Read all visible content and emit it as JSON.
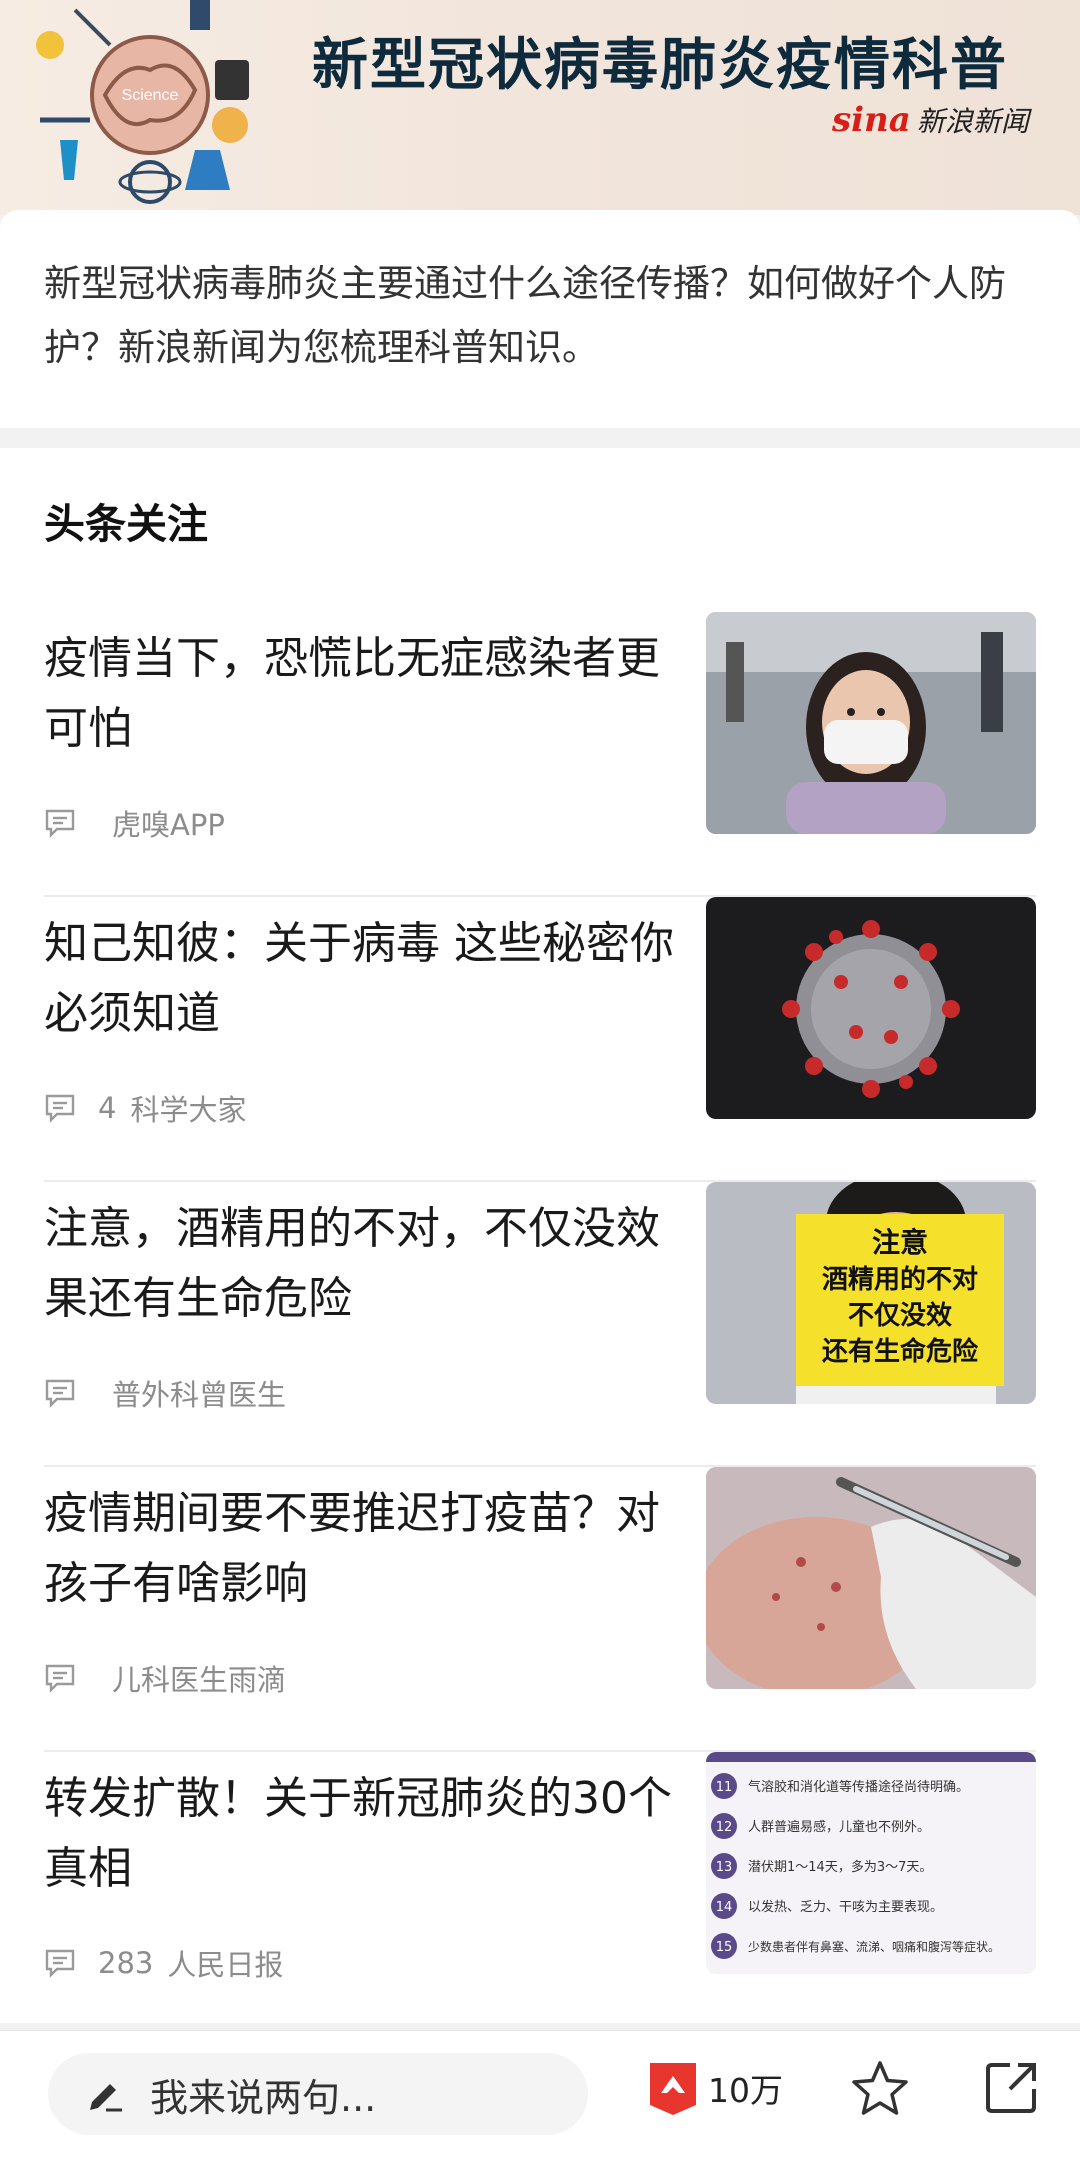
{
  "banner": {
    "title": "新型冠状病毒肺炎疫情科普",
    "illustration_label": "Science",
    "logo_mark": "sina",
    "logo_text": "新浪新闻"
  },
  "intro": {
    "text": "新型冠状病毒肺炎主要通过什么途径传播？如何做好个人防护？新浪新闻为您梳理科普知识。"
  },
  "section": {
    "title": "头条关注"
  },
  "articles": [
    {
      "title": "疫情当下，恐慌比无症感染者更可怕",
      "comment_count": "",
      "source": "虎嗅APP",
      "thumb": "girl-mask-photo"
    },
    {
      "title": "知己知彼：关于病毒 这些秘密你必须知道",
      "comment_count": "4",
      "source": "科学大家",
      "thumb": "virus-render"
    },
    {
      "title": "注意，酒精用的不对，不仅没效果还有生命危险",
      "comment_count": "",
      "source": "普外科曾医生",
      "thumb": "alcohol-warning",
      "thumb_text": [
        "注意",
        "酒精用的不对",
        "不仅没效",
        "还有生命危险"
      ]
    },
    {
      "title": "疫情期间要不要推迟打疫苗？对孩子有啥影响",
      "comment_count": "",
      "source": "儿科医生雨滴",
      "thumb": "vaccine-photo"
    },
    {
      "title": "转发扩散！关于新冠肺炎的30个真相",
      "comment_count": "283",
      "source": "人民日报",
      "thumb": "facts-list",
      "thumb_list": [
        {
          "n": "11",
          "text": "气溶胶和消化道等传播途径尚待明确。"
        },
        {
          "n": "12",
          "text": "人群普遍易感，儿童也不例外。"
        },
        {
          "n": "13",
          "text": "潜伏期1～14天，多为3～7天。"
        },
        {
          "n": "14",
          "text": "以发热、乏力、干咳为主要表现。"
        },
        {
          "n": "15",
          "text": "少数患者伴有鼻塞、流涕、咽痛和腹泻等症状。"
        }
      ]
    }
  ],
  "bottom_bar": {
    "comment_placeholder": "我来说两句...",
    "like_count": "10万"
  },
  "colors": {
    "banner_title": "#0e2a3d",
    "sina_red": "#d91e18",
    "like_red": "#e8352d",
    "meta_gray": "#8c8c8c"
  }
}
